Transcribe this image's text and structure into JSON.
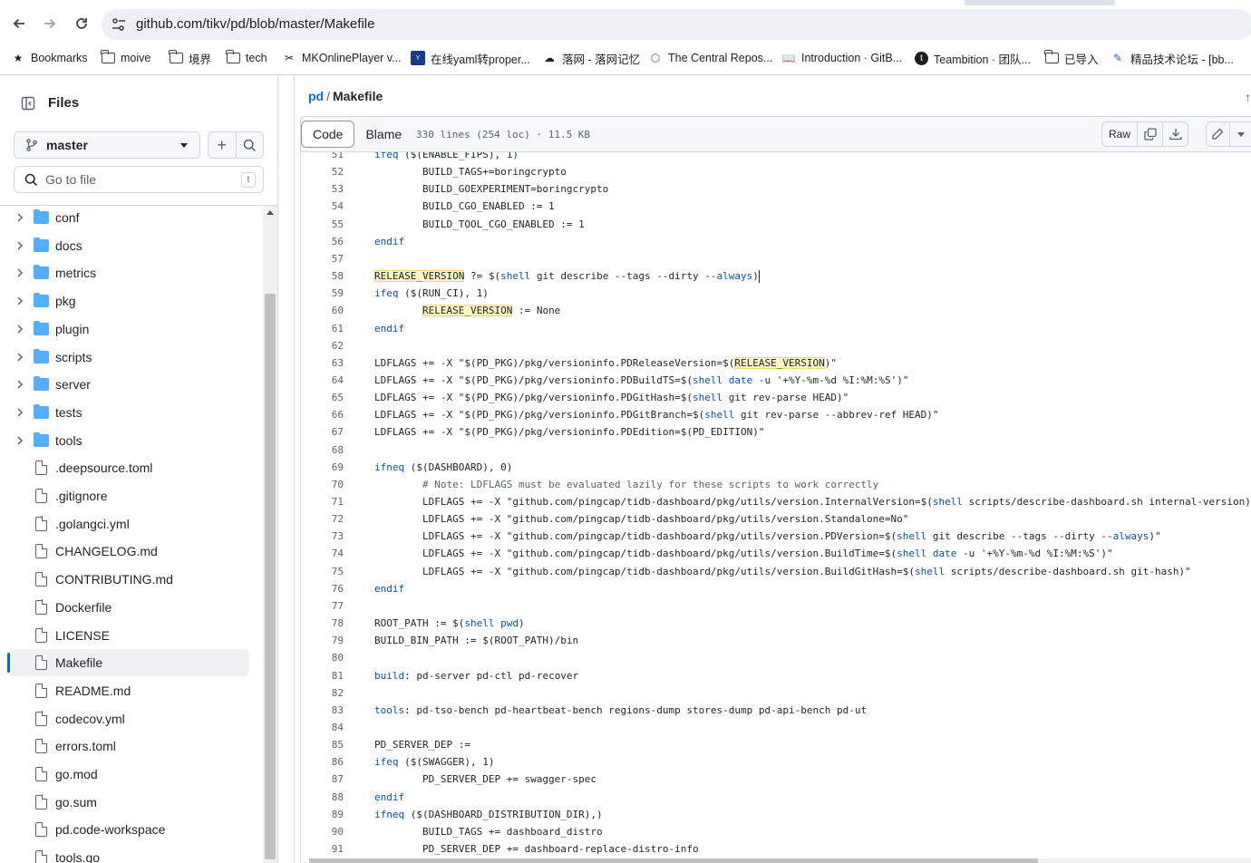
{
  "browser": {
    "url": "github.com/tikv/pd/blob/master/Makefile",
    "bookmarks": [
      {
        "label": "Bookmarks",
        "icon": "star-icon"
      },
      {
        "label": "moive",
        "icon": "folder-icon"
      },
      {
        "label": "境界",
        "icon": "folder-icon"
      },
      {
        "label": "tech",
        "icon": "folder-icon"
      },
      {
        "label": "MKOnlinePlayer v...",
        "icon": "player-icon"
      },
      {
        "label": "在线yaml转proper...",
        "icon": "yaml-icon"
      },
      {
        "label": "落网 - 落网记忆",
        "icon": "luowang-icon"
      },
      {
        "label": "The Central Repos...",
        "icon": "maven-icon"
      },
      {
        "label": "Introduction · GitB...",
        "icon": "book-icon"
      },
      {
        "label": "Teambition · 团队...",
        "icon": "teambition-icon"
      },
      {
        "label": "已导入",
        "icon": "folder-icon"
      },
      {
        "label": "精品技术论坛 - [bb...",
        "icon": "forum-icon"
      }
    ]
  },
  "sidebar": {
    "title": "Files",
    "branch": "master",
    "search_placeholder": "Go to file",
    "search_shortcut": "t",
    "items": [
      {
        "label": "conf",
        "type": "folder"
      },
      {
        "label": "docs",
        "type": "folder"
      },
      {
        "label": "metrics",
        "type": "folder"
      },
      {
        "label": "pkg",
        "type": "folder"
      },
      {
        "label": "plugin",
        "type": "folder"
      },
      {
        "label": "scripts",
        "type": "folder"
      },
      {
        "label": "server",
        "type": "folder"
      },
      {
        "label": "tests",
        "type": "folder"
      },
      {
        "label": "tools",
        "type": "folder"
      },
      {
        "label": ".deepsource.toml",
        "type": "file"
      },
      {
        "label": ".gitignore",
        "type": "file"
      },
      {
        "label": ".golangci.yml",
        "type": "file"
      },
      {
        "label": "CHANGELOG.md",
        "type": "file"
      },
      {
        "label": "CONTRIBUTING.md",
        "type": "file"
      },
      {
        "label": "Dockerfile",
        "type": "file"
      },
      {
        "label": "LICENSE",
        "type": "file"
      },
      {
        "label": "Makefile",
        "type": "file",
        "active": true
      },
      {
        "label": "README.md",
        "type": "file"
      },
      {
        "label": "codecov.yml",
        "type": "file"
      },
      {
        "label": "errors.toml",
        "type": "file"
      },
      {
        "label": "go.mod",
        "type": "file"
      },
      {
        "label": "go.sum",
        "type": "file"
      },
      {
        "label": "pd.code-workspace",
        "type": "file"
      },
      {
        "label": "tools.go",
        "type": "file"
      }
    ]
  },
  "main": {
    "breadcrumb_repo": "pd",
    "breadcrumb_sep": "/",
    "breadcrumb_file": "Makefile",
    "tabs": {
      "code": "Code",
      "blame": "Blame"
    },
    "file_meta": "330 lines (254 loc) · 11.5 KB",
    "raw_label": "Raw",
    "code_lines": [
      {
        "n": "51",
        "t": "ifeq ($(ENABLE_FIPS), 1)"
      },
      {
        "n": "52",
        "t": "        BUILD_TAGS+=boringcrypto"
      },
      {
        "n": "53",
        "t": "        BUILD_GOEXPERIMENT=boringcrypto"
      },
      {
        "n": "54",
        "t": "        BUILD_CGO_ENABLED := 1"
      },
      {
        "n": "55",
        "t": "        BUILD_TOOL_CGO_ENABLED := 1"
      },
      {
        "n": "56",
        "t": "endif"
      },
      {
        "n": "57",
        "t": ""
      },
      {
        "n": "58",
        "t": "RELEASE_VERSION ?= $(shell git describe --tags --dirty --always)"
      },
      {
        "n": "59",
        "t": "ifeq ($(RUN_CI), 1)"
      },
      {
        "n": "60",
        "t": "        RELEASE_VERSION := None"
      },
      {
        "n": "61",
        "t": "endif"
      },
      {
        "n": "62",
        "t": ""
      },
      {
        "n": "63",
        "t": "LDFLAGS += -X \"$(PD_PKG)/pkg/versioninfo.PDReleaseVersion=$(RELEASE_VERSION)\""
      },
      {
        "n": "64",
        "t": "LDFLAGS += -X \"$(PD_PKG)/pkg/versioninfo.PDBuildTS=$(shell date -u '+%Y-%m-%d %I:%M:%S')\""
      },
      {
        "n": "65",
        "t": "LDFLAGS += -X \"$(PD_PKG)/pkg/versioninfo.PDGitHash=$(shell git rev-parse HEAD)\""
      },
      {
        "n": "66",
        "t": "LDFLAGS += -X \"$(PD_PKG)/pkg/versioninfo.PDGitBranch=$(shell git rev-parse --abbrev-ref HEAD)\""
      },
      {
        "n": "67",
        "t": "LDFLAGS += -X \"$(PD_PKG)/pkg/versioninfo.PDEdition=$(PD_EDITION)\""
      },
      {
        "n": "68",
        "t": ""
      },
      {
        "n": "69",
        "t": "ifneq ($(DASHBOARD), 0)"
      },
      {
        "n": "70",
        "t": "        # Note: LDFLAGS must be evaluated lazily for these scripts to work correctly"
      },
      {
        "n": "71",
        "t": "        LDFLAGS += -X \"github.com/pingcap/tidb-dashboard/pkg/utils/version.InternalVersion=$(shell scripts/describe-dashboard.sh internal-version)\""
      },
      {
        "n": "72",
        "t": "        LDFLAGS += -X \"github.com/pingcap/tidb-dashboard/pkg/utils/version.Standalone=No\""
      },
      {
        "n": "73",
        "t": "        LDFLAGS += -X \"github.com/pingcap/tidb-dashboard/pkg/utils/version.PDVersion=$(shell git describe --tags --dirty --always)\""
      },
      {
        "n": "74",
        "t": "        LDFLAGS += -X \"github.com/pingcap/tidb-dashboard/pkg/utils/version.BuildTime=$(shell date -u '+%Y-%m-%d %I:%M:%S')\""
      },
      {
        "n": "75",
        "t": "        LDFLAGS += -X \"github.com/pingcap/tidb-dashboard/pkg/utils/version.BuildGitHash=$(shell scripts/describe-dashboard.sh git-hash)\""
      },
      {
        "n": "76",
        "t": "endif"
      },
      {
        "n": "77",
        "t": ""
      },
      {
        "n": "78",
        "t": "ROOT_PATH := $(shell pwd)"
      },
      {
        "n": "79",
        "t": "BUILD_BIN_PATH := $(ROOT_PATH)/bin"
      },
      {
        "n": "80",
        "t": ""
      },
      {
        "n": "81",
        "t": "build: pd-server pd-ctl pd-recover"
      },
      {
        "n": "82",
        "t": ""
      },
      {
        "n": "83",
        "t": "tools: pd-tso-bench pd-heartbeat-bench regions-dump stores-dump pd-api-bench pd-ut"
      },
      {
        "n": "84",
        "t": ""
      },
      {
        "n": "85",
        "t": "PD_SERVER_DEP :="
      },
      {
        "n": "86",
        "t": "ifeq ($(SWAGGER), 1)"
      },
      {
        "n": "87",
        "t": "        PD_SERVER_DEP += swagger-spec"
      },
      {
        "n": "88",
        "t": "endif"
      },
      {
        "n": "89",
        "t": "ifneq ($(DASHBOARD_DISTRIBUTION_DIR),)"
      },
      {
        "n": "90",
        "t": "        BUILD_TAGS += dashboard_distro"
      },
      {
        "n": "91",
        "t": "        PD_SERVER_DEP += dashboard-replace-distro-info"
      }
    ],
    "highlight_word": "RELEASE_VERSION"
  },
  "colors": {
    "accent": "#0969da",
    "folder": "#54aeff",
    "keyword": "#0550ae",
    "highlight": "#fff8c5"
  }
}
